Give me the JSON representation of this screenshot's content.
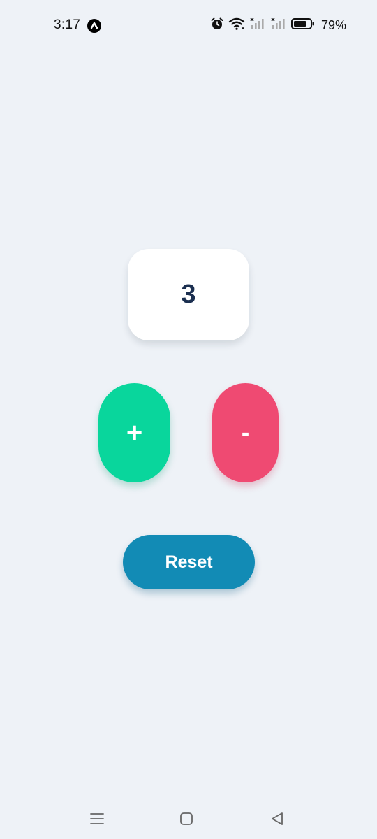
{
  "status_bar": {
    "time": "3:17",
    "app_badge_icon": "app-notification-icon",
    "icons": [
      "alarm-icon",
      "wifi-icon",
      "signal-icon",
      "signal-icon"
    ],
    "battery_percent": "79%",
    "battery_level": 0.79
  },
  "counter": {
    "value": "3"
  },
  "buttons": {
    "increment_label": "+",
    "decrement_label": "-",
    "reset_label": "Reset"
  },
  "colors": {
    "background": "#eef2f7",
    "counter_text": "#1b2f50",
    "increment": "#09d69c",
    "decrement": "#ef4a72",
    "reset": "#128bb5"
  },
  "nav_bar": {
    "icons": [
      "menu-icon",
      "home-icon",
      "back-icon"
    ]
  }
}
